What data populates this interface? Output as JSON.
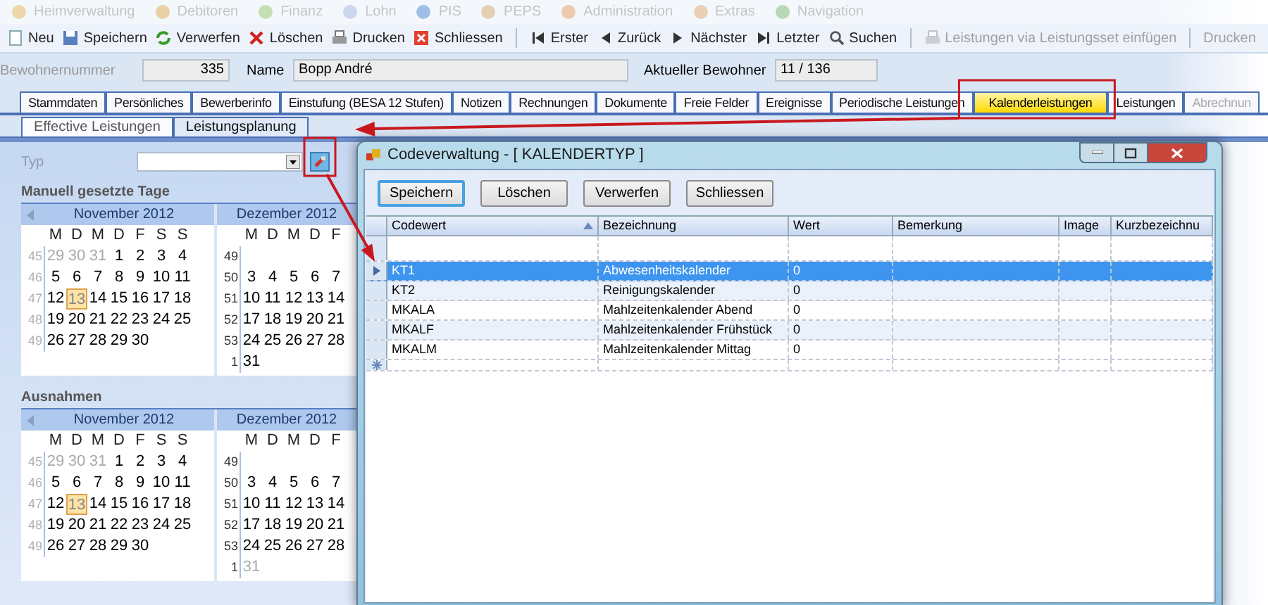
{
  "menu": [
    {
      "label": "Heimverwaltung"
    },
    {
      "label": "Debitoren"
    },
    {
      "label": "Finanz"
    },
    {
      "label": "Lohn"
    },
    {
      "label": "PIS"
    },
    {
      "label": "PEPS"
    },
    {
      "label": "Administration"
    },
    {
      "label": "Extras"
    },
    {
      "label": "Navigation"
    }
  ],
  "toolbar": [
    {
      "kind": "button",
      "label": "Neu",
      "disabled": false
    },
    {
      "kind": "button",
      "label": "Speichern",
      "disabled": false
    },
    {
      "kind": "button",
      "label": "Verwerfen",
      "disabled": false
    },
    {
      "kind": "button",
      "label": "Löschen",
      "disabled": false
    },
    {
      "kind": "button",
      "label": "Drucken",
      "disabled": false
    },
    {
      "kind": "button",
      "label": "Schliessen",
      "disabled": false
    },
    {
      "kind": "separator"
    },
    {
      "kind": "button",
      "label": "Erster",
      "disabled": false
    },
    {
      "kind": "button",
      "label": "Zurück",
      "disabled": false
    },
    {
      "kind": "button",
      "label": "Nächster",
      "disabled": false
    },
    {
      "kind": "button",
      "label": "Letzter",
      "disabled": false
    },
    {
      "kind": "button",
      "label": "Suchen",
      "disabled": false
    },
    {
      "kind": "separator"
    },
    {
      "kind": "button",
      "label": "Leistungen via Leistungsset einfügen",
      "disabled": true
    },
    {
      "kind": "separator"
    },
    {
      "kind": "button",
      "label": "Drucken",
      "disabled": true
    }
  ],
  "header_fields": [
    {
      "label": "Bewohnernummer",
      "value": "335"
    },
    {
      "label": "Name",
      "value": "Bopp André"
    },
    {
      "label": "Aktueller Bewohner",
      "value": "11 / 136"
    }
  ],
  "tabs": [
    {
      "label": "Stammdaten",
      "selected": false,
      "disabled": false
    },
    {
      "label": "Persönliches",
      "selected": false,
      "disabled": false
    },
    {
      "label": "Bewerberinfo",
      "selected": false,
      "disabled": false
    },
    {
      "label": "Einstufung (BESA 12 Stufen)",
      "selected": false,
      "disabled": false
    },
    {
      "label": "Notizen",
      "selected": false,
      "disabled": false
    },
    {
      "label": "Rechnungen",
      "selected": false,
      "disabled": false
    },
    {
      "label": "Dokumente",
      "selected": false,
      "disabled": false
    },
    {
      "label": "Freie Felder",
      "selected": false,
      "disabled": false
    },
    {
      "label": "Ereignisse",
      "selected": false,
      "disabled": false
    },
    {
      "label": "Periodische Leistungen",
      "selected": false,
      "disabled": false
    },
    {
      "label": "Kalenderleistungen",
      "selected": true,
      "disabled": false
    },
    {
      "label": "Leistungen",
      "selected": false,
      "disabled": false
    },
    {
      "label": "Abrechnun",
      "selected": false,
      "disabled": true
    }
  ],
  "subtabs": [
    {
      "label": "Effective Leistungen",
      "selected": true
    },
    {
      "label": "Leistungsplanung",
      "selected": false
    }
  ],
  "typ": {
    "label": "Typ"
  },
  "sections": [
    {
      "title": "Manuell gesetzte Tage",
      "months": [
        {
          "title": "November 2012",
          "weekdays": [
            "M",
            "D",
            "M",
            "D",
            "F",
            "S",
            "S"
          ],
          "weeks": [
            {
              "number": "45",
              "days": [
                {
                  "day": "29",
                  "muted": true,
                  "today": false
                },
                {
                  "day": "30",
                  "muted": true,
                  "today": false
                },
                {
                  "day": "31",
                  "muted": true,
                  "today": false
                },
                {
                  "day": "1",
                  "muted": false,
                  "today": false
                },
                {
                  "day": "2",
                  "muted": false,
                  "today": false
                },
                {
                  "day": "3",
                  "muted": false,
                  "today": false
                },
                {
                  "day": "4",
                  "muted": false,
                  "today": false
                }
              ]
            },
            {
              "number": "46",
              "days": [
                {
                  "day": "5",
                  "muted": false,
                  "today": false
                },
                {
                  "day": "6",
                  "muted": false,
                  "today": false
                },
                {
                  "day": "7",
                  "muted": false,
                  "today": false
                },
                {
                  "day": "8",
                  "muted": false,
                  "today": false
                },
                {
                  "day": "9",
                  "muted": false,
                  "today": false
                },
                {
                  "day": "10",
                  "muted": false,
                  "today": false
                },
                {
                  "day": "11",
                  "muted": false,
                  "today": false
                }
              ]
            },
            {
              "number": "47",
              "days": [
                {
                  "day": "12",
                  "muted": false,
                  "today": false
                },
                {
                  "day": "13",
                  "muted": false,
                  "today": true
                },
                {
                  "day": "14",
                  "muted": false,
                  "today": false
                },
                {
                  "day": "15",
                  "muted": false,
                  "today": false
                },
                {
                  "day": "16",
                  "muted": false,
                  "today": false
                },
                {
                  "day": "17",
                  "muted": false,
                  "today": false
                },
                {
                  "day": "18",
                  "muted": false,
                  "today": false
                }
              ]
            },
            {
              "number": "48",
              "days": [
                {
                  "day": "19",
                  "muted": false,
                  "today": false
                },
                {
                  "day": "20",
                  "muted": false,
                  "today": false
                },
                {
                  "day": "21",
                  "muted": false,
                  "today": false
                },
                {
                  "day": "22",
                  "muted": false,
                  "today": false
                },
                {
                  "day": "23",
                  "muted": false,
                  "today": false
                },
                {
                  "day": "24",
                  "muted": false,
                  "today": false
                },
                {
                  "day": "25",
                  "muted": false,
                  "today": false
                }
              ]
            },
            {
              "number": "49",
              "days": [
                {
                  "day": "26",
                  "muted": false,
                  "today": false
                },
                {
                  "day": "27",
                  "muted": false,
                  "today": false
                },
                {
                  "day": "28",
                  "muted": false,
                  "today": false
                },
                {
                  "day": "29",
                  "muted": false,
                  "today": false
                },
                {
                  "day": "30",
                  "muted": false,
                  "today": false
                }
              ]
            }
          ]
        },
        {
          "title": "Dezember 2012",
          "weekdays": [
            "M",
            "D",
            "M",
            "D",
            "F"
          ],
          "weeks": [
            {
              "number": "49"
            },
            {
              "number": "50",
              "days": [
                {
                  "day": "3",
                  "muted": false,
                  "today": false
                },
                {
                  "day": "4",
                  "muted": false,
                  "today": false
                },
                {
                  "day": "5",
                  "muted": false,
                  "today": false
                },
                {
                  "day": "6",
                  "muted": false,
                  "today": false
                },
                {
                  "day": "7",
                  "muted": false,
                  "today": false
                }
              ]
            },
            {
              "number": "51",
              "days": [
                {
                  "day": "10",
                  "muted": false,
                  "today": false
                },
                {
                  "day": "11",
                  "muted": false,
                  "today": false
                },
                {
                  "day": "12",
                  "muted": false,
                  "today": false
                },
                {
                  "day": "13",
                  "muted": false,
                  "today": false
                },
                {
                  "day": "14",
                  "muted": false,
                  "today": false
                }
              ]
            },
            {
              "number": "52",
              "days": [
                {
                  "day": "17",
                  "muted": false,
                  "today": false
                },
                {
                  "day": "18",
                  "muted": false,
                  "today": false
                },
                {
                  "day": "19",
                  "muted": false,
                  "today": false
                },
                {
                  "day": "20",
                  "muted": false,
                  "today": false
                },
                {
                  "day": "21",
                  "muted": false,
                  "today": false
                }
              ]
            },
            {
              "number": "53",
              "days": [
                {
                  "day": "24",
                  "muted": false,
                  "today": false
                },
                {
                  "day": "25",
                  "muted": false,
                  "today": false
                },
                {
                  "day": "26",
                  "muted": false,
                  "today": false
                },
                {
                  "day": "27",
                  "muted": false,
                  "today": false
                },
                {
                  "day": "28",
                  "muted": false,
                  "today": false
                }
              ]
            },
            {
              "number": "1",
              "days": [
                {
                  "day": "31",
                  "muted": false,
                  "today": false
                }
              ]
            }
          ]
        }
      ]
    },
    {
      "title": "Ausnahmen",
      "months": [
        {
          "title": "November 2012",
          "weekdays": [
            "M",
            "D",
            "M",
            "D",
            "F",
            "S",
            "S"
          ],
          "weeks": [
            {
              "number": "45",
              "days": [
                {
                  "day": "29",
                  "muted": true,
                  "today": false
                },
                {
                  "day": "30",
                  "muted": true,
                  "today": false
                },
                {
                  "day": "31",
                  "muted": true,
                  "today": false
                },
                {
                  "day": "1",
                  "muted": false,
                  "today": false
                },
                {
                  "day": "2",
                  "muted": false,
                  "today": false
                },
                {
                  "day": "3",
                  "muted": false,
                  "today": false
                },
                {
                  "day": "4",
                  "muted": false,
                  "today": false
                }
              ]
            },
            {
              "number": "46",
              "days": [
                {
                  "day": "5",
                  "muted": false,
                  "today": false
                },
                {
                  "day": "6",
                  "muted": false,
                  "today": false
                },
                {
                  "day": "7",
                  "muted": false,
                  "today": false
                },
                {
                  "day": "8",
                  "muted": false,
                  "today": false
                },
                {
                  "day": "9",
                  "muted": false,
                  "today": false
                },
                {
                  "day": "10",
                  "muted": false,
                  "today": false
                },
                {
                  "day": "11",
                  "muted": false,
                  "today": false
                }
              ]
            },
            {
              "number": "47",
              "days": [
                {
                  "day": "12",
                  "muted": false,
                  "today": false
                },
                {
                  "day": "13",
                  "muted": false,
                  "today": true
                },
                {
                  "day": "14",
                  "muted": false,
                  "today": false
                },
                {
                  "day": "15",
                  "muted": false,
                  "today": false
                },
                {
                  "day": "16",
                  "muted": false,
                  "today": false
                },
                {
                  "day": "17",
                  "muted": false,
                  "today": false
                },
                {
                  "day": "18",
                  "muted": false,
                  "today": false
                }
              ]
            },
            {
              "number": "48",
              "days": [
                {
                  "day": "19",
                  "muted": false,
                  "today": false
                },
                {
                  "day": "20",
                  "muted": false,
                  "today": false
                },
                {
                  "day": "21",
                  "muted": false,
                  "today": false
                },
                {
                  "day": "22",
                  "muted": false,
                  "today": false
                },
                {
                  "day": "23",
                  "muted": false,
                  "today": false
                },
                {
                  "day": "24",
                  "muted": false,
                  "today": false
                },
                {
                  "day": "25",
                  "muted": false,
                  "today": false
                }
              ]
            },
            {
              "number": "49",
              "days": [
                {
                  "day": "26",
                  "muted": false,
                  "today": false
                },
                {
                  "day": "27",
                  "muted": false,
                  "today": false
                },
                {
                  "day": "28",
                  "muted": false,
                  "today": false
                },
                {
                  "day": "29",
                  "muted": false,
                  "today": false
                },
                {
                  "day": "30",
                  "muted": false,
                  "today": false
                }
              ]
            }
          ]
        },
        {
          "title": "Dezember 2012",
          "weekdays": [
            "M",
            "D",
            "M",
            "D",
            "F"
          ],
          "weeks": [
            {
              "number": "49"
            },
            {
              "number": "50",
              "days": [
                {
                  "day": "3",
                  "muted": false,
                  "today": false
                },
                {
                  "day": "4",
                  "muted": false,
                  "today": false
                },
                {
                  "day": "5",
                  "muted": false,
                  "today": false
                },
                {
                  "day": "6",
                  "muted": false,
                  "today": false
                },
                {
                  "day": "7",
                  "muted": false,
                  "today": false
                }
              ]
            },
            {
              "number": "51",
              "days": [
                {
                  "day": "10",
                  "muted": false,
                  "today": false
                },
                {
                  "day": "11",
                  "muted": false,
                  "today": false
                },
                {
                  "day": "12",
                  "muted": false,
                  "today": false
                },
                {
                  "day": "13",
                  "muted": false,
                  "today": false
                },
                {
                  "day": "14",
                  "muted": false,
                  "today": false
                }
              ]
            },
            {
              "number": "52",
              "days": [
                {
                  "day": "17",
                  "muted": false,
                  "today": false
                },
                {
                  "day": "18",
                  "muted": false,
                  "today": false
                },
                {
                  "day": "19",
                  "muted": false,
                  "today": false
                },
                {
                  "day": "20",
                  "muted": false,
                  "today": false
                },
                {
                  "day": "21",
                  "muted": false,
                  "today": false
                }
              ]
            },
            {
              "number": "53",
              "days": [
                {
                  "day": "24",
                  "muted": false,
                  "today": false
                },
                {
                  "day": "25",
                  "muted": false,
                  "today": false
                },
                {
                  "day": "26",
                  "muted": false,
                  "today": false
                },
                {
                  "day": "27",
                  "muted": false,
                  "today": false
                },
                {
                  "day": "28",
                  "muted": false,
                  "today": false
                }
              ]
            },
            {
              "number": "1",
              "days": [
                {
                  "day": "31",
                  "muted": true,
                  "today": false
                }
              ]
            }
          ]
        }
      ]
    }
  ],
  "dialog": {
    "title": "Codeverwaltung - [ KALENDERTYP ]",
    "buttons": [
      {
        "label": "Speichern",
        "focused": true
      },
      {
        "label": "Löschen",
        "focused": false
      },
      {
        "label": "Verwerfen",
        "focused": false
      },
      {
        "label": "Schliessen",
        "focused": false
      }
    ],
    "columns": [
      {
        "label": "Codewert",
        "sorted": true
      },
      {
        "label": "Bezeichnung",
        "sorted": false
      },
      {
        "label": "Wert",
        "sorted": false
      },
      {
        "label": "Bemerkung",
        "sorted": false
      },
      {
        "label": "Image",
        "sorted": false
      },
      {
        "label": "Kurzbezeichnu",
        "sorted": false
      }
    ],
    "rows": [
      {
        "cells": [
          "KT1",
          "Abwesenheitskalender",
          "0"
        ],
        "selected": true
      },
      {
        "cells": [
          "KT2",
          "Reinigungskalender",
          "0"
        ],
        "selected": false
      },
      {
        "cells": [
          "MKALA",
          "Mahlzeitenkalender Abend",
          "0"
        ],
        "selected": false
      },
      {
        "cells": [
          "MKALF",
          "Mahlzeitenkalender Frühstück",
          "0"
        ],
        "selected": false
      },
      {
        "cells": [
          "MKALM",
          "Mahlzeitenkalender Mittag",
          "0"
        ],
        "selected": false
      }
    ]
  }
}
